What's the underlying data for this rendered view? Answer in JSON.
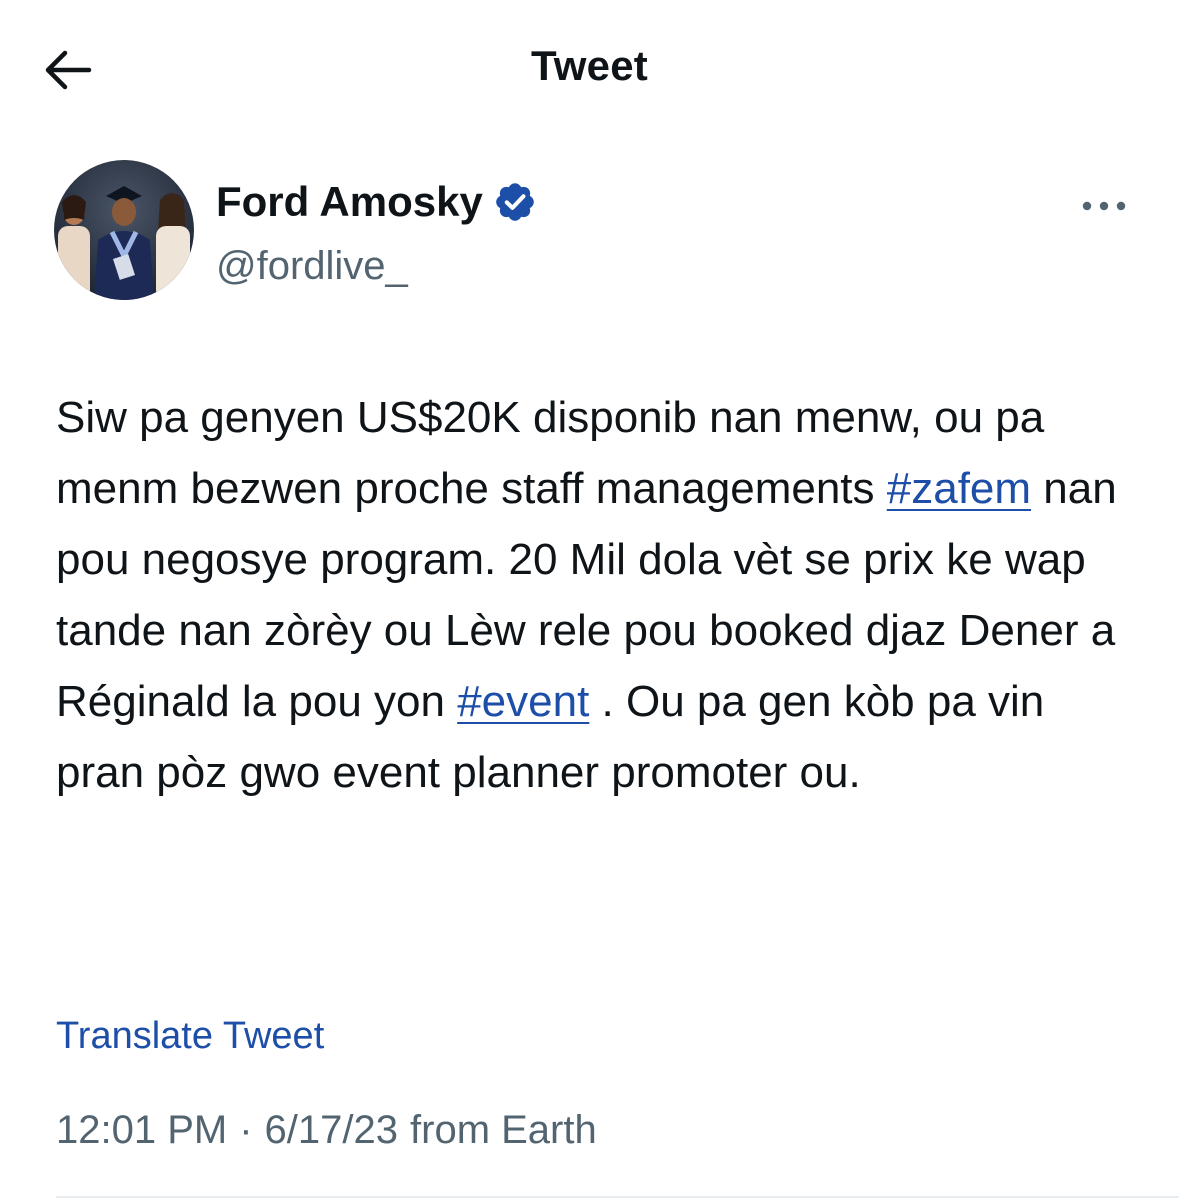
{
  "header": {
    "back_icon": "arrow-left-icon",
    "title": "Tweet"
  },
  "author": {
    "display_name": "Ford Amosky",
    "verified_icon": "verified-badge-icon",
    "handle": "@fordlive_",
    "more_icon": "more-horizontal-icon"
  },
  "tweet": {
    "text_part1": "Siw pa genyen US$20K disponib nan menw, ou pa menm bezwen proche staff managements ",
    "hashtag1": "#zafem",
    "text_part2": " nan pou negosye program. 20 Mil dola vèt se prix ke wap tande nan zòrèy ou Lèw rele pou booked djaz Dener a Réginald la pou yon ",
    "hashtag2": "#event",
    "text_part3": " . Ou pa gen kòb pa vin pran pòz gwo event planner promoter ou."
  },
  "translate_label": "Translate Tweet",
  "meta": {
    "time": "12:01 PM",
    "separator": "·",
    "date": "6/17/23",
    "source": "from Earth"
  },
  "colors": {
    "link": "#1d4ea8",
    "verified": "#1d9bf0",
    "secondary_text": "#536471",
    "primary_text": "#0f1419"
  }
}
